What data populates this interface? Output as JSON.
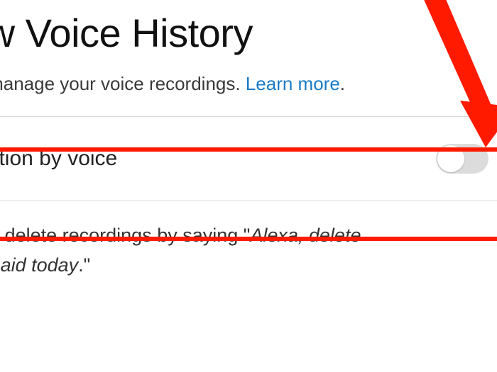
{
  "header": {
    "title": "Review Voice History",
    "subtitle_prefix": "Review and manage your voice recordings. ",
    "learn_more": "Learn more",
    "subtitle_suffix": "."
  },
  "setting": {
    "label": "Enable deletion by voice",
    "toggle_state": "off"
  },
  "description": {
    "line1_prefix": "Allows you to delete recordings by saying \"",
    "line1_italic": "Alexa, delete",
    "line2_italic": "everything I said today",
    "line2_suffix": ".\""
  },
  "colors": {
    "callout_red": "#ff1a00",
    "link": "#1a7bc6"
  }
}
